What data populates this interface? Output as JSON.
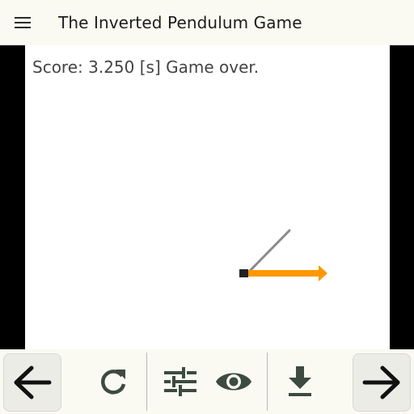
{
  "app_bar": {
    "title": "The Inverted Pendulum Game",
    "menu_icon": "menu-icon"
  },
  "game": {
    "score_text": "Score: 3.250 [s] Game over.",
    "cart_color": "#222222",
    "pole_color": "#8a8a8a",
    "force_arrow_color": "#ff9800"
  },
  "toolbar": {
    "back_icon": "arrow-left-icon",
    "reset_icon": "refresh-icon",
    "settings_icon": "tune-icon",
    "view_icon": "eye-icon",
    "download_icon": "download-icon",
    "forward_icon": "arrow-right-icon"
  },
  "colors": {
    "bar_background": "#fafaf2",
    "icon_dark": "#2b2b2b",
    "icon_muted": "#3d4a3f"
  }
}
